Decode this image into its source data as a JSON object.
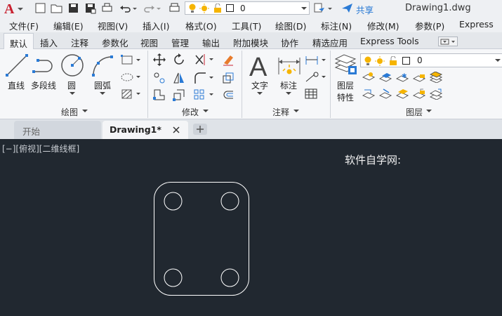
{
  "title": "Drawing1.dwg",
  "quick_access": {
    "layer_value": "0",
    "share_label": "共享"
  },
  "menus": [
    "文件(F)",
    "编辑(E)",
    "视图(V)",
    "插入(I)",
    "格式(O)",
    "工具(T)",
    "绘图(D)",
    "标注(N)",
    "修改(M)",
    "参数(P)",
    "Express"
  ],
  "ribbon_tabs": [
    "默认",
    "插入",
    "注释",
    "参数化",
    "视图",
    "管理",
    "输出",
    "附加模块",
    "协作",
    "精选应用",
    "Express Tools"
  ],
  "active_tab": "默认",
  "draw_panel": {
    "title": "绘图",
    "line": "直线",
    "polyline": "多段线",
    "circle": "圆",
    "arc": "圆弧"
  },
  "modify_panel": {
    "title": "修改"
  },
  "annotation_panel": {
    "title": "注释",
    "text": "文字",
    "dimension": "标注"
  },
  "layers_panel": {
    "title": "图层",
    "layer_properties_line1": "图层",
    "layer_properties_line2": "特性",
    "current_layer": "0"
  },
  "file_tabs": [
    {
      "label": "开始",
      "active": false
    },
    {
      "label": "Drawing1*",
      "active": true
    }
  ],
  "viewport": {
    "controls": "[−][俯视][二维线框]",
    "watermark": "软件自学网:"
  },
  "colors": {
    "viewport_bg": "#212830",
    "accent": "#2a7ad5",
    "app_red": "#c8202f"
  }
}
